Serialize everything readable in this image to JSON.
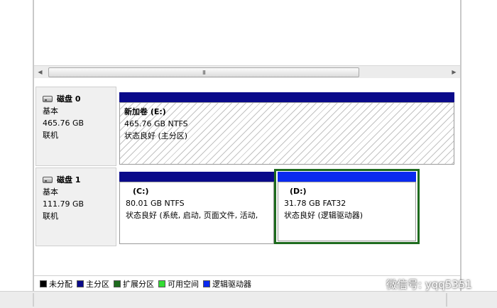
{
  "scrollbar": {
    "grip": "III"
  },
  "disks": [
    {
      "title": "磁盘 0",
      "type": "基本",
      "size": "465.76 GB",
      "status": "联机",
      "partitions": [
        {
          "name": "新加卷  (E:)",
          "detail": "465.76 GB NTFS",
          "status": "状态良好 (主分区)"
        }
      ]
    },
    {
      "title": "磁盘 1",
      "type": "基本",
      "size": "111.79 GB",
      "status": "联机",
      "partitions": [
        {
          "name": "(C:)",
          "detail": "80.01 GB NTFS",
          "status": "状态良好 (系统, 启动, 页面文件, 活动,"
        },
        {
          "name": "(D:)",
          "detail": "31.78 GB FAT32",
          "status": "状态良好 (逻辑驱动器)"
        }
      ]
    }
  ],
  "legend": [
    {
      "label": "未分配",
      "color": "#000000"
    },
    {
      "label": "主分区",
      "color": "#0a0a8a"
    },
    {
      "label": "扩展分区",
      "color": "#1e6b1e"
    },
    {
      "label": "可用空间",
      "color": "#33dd33"
    },
    {
      "label": "逻辑驱动器",
      "color": "#0b2af0"
    }
  ],
  "watermark": {
    "text": "微信号: yqq5351"
  }
}
